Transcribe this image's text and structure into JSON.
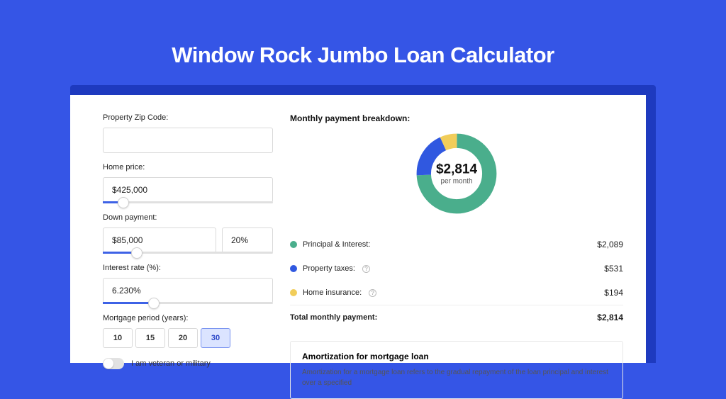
{
  "title": "Window Rock Jumbo Loan Calculator",
  "fields": {
    "zip": {
      "label": "Property Zip Code:",
      "value": ""
    },
    "home_price": {
      "label": "Home price:",
      "value": "$425,000",
      "slider_pct": 12
    },
    "down_payment": {
      "label": "Down payment:",
      "value": "$85,000",
      "pct_value": "20%",
      "slider_pct": 20
    },
    "interest_rate": {
      "label": "Interest rate (%):",
      "value": "6.230%",
      "slider_pct": 30
    },
    "period": {
      "label": "Mortgage period (years):",
      "options": [
        "10",
        "15",
        "20",
        "30"
      ],
      "selected": "30"
    },
    "veteran": {
      "label": "I am veteran or military",
      "checked": false
    }
  },
  "breakdown": {
    "title": "Monthly payment breakdown:",
    "center_value": "$2,814",
    "center_sub": "per month",
    "items": [
      {
        "label": "Principal & Interest:",
        "value": "$2,089",
        "color": "#4aae8c",
        "info": false
      },
      {
        "label": "Property taxes:",
        "value": "$531",
        "color": "#3058e0",
        "info": true
      },
      {
        "label": "Home insurance:",
        "value": "$194",
        "color": "#f1cd5a",
        "info": true
      }
    ],
    "total_label": "Total monthly payment:",
    "total_value": "$2,814"
  },
  "chart_data": {
    "type": "pie",
    "title": "Monthly payment breakdown",
    "series": [
      {
        "name": "Principal & Interest",
        "value": 2089,
        "color": "#4aae8c"
      },
      {
        "name": "Property taxes",
        "value": 531,
        "color": "#3058e0"
      },
      {
        "name": "Home insurance",
        "value": 194,
        "color": "#f1cd5a"
      }
    ]
  },
  "amort": {
    "title": "Amortization for mortgage loan",
    "text": "Amortization for a mortgage loan refers to the gradual repayment of the loan principal and interest over a specified"
  }
}
